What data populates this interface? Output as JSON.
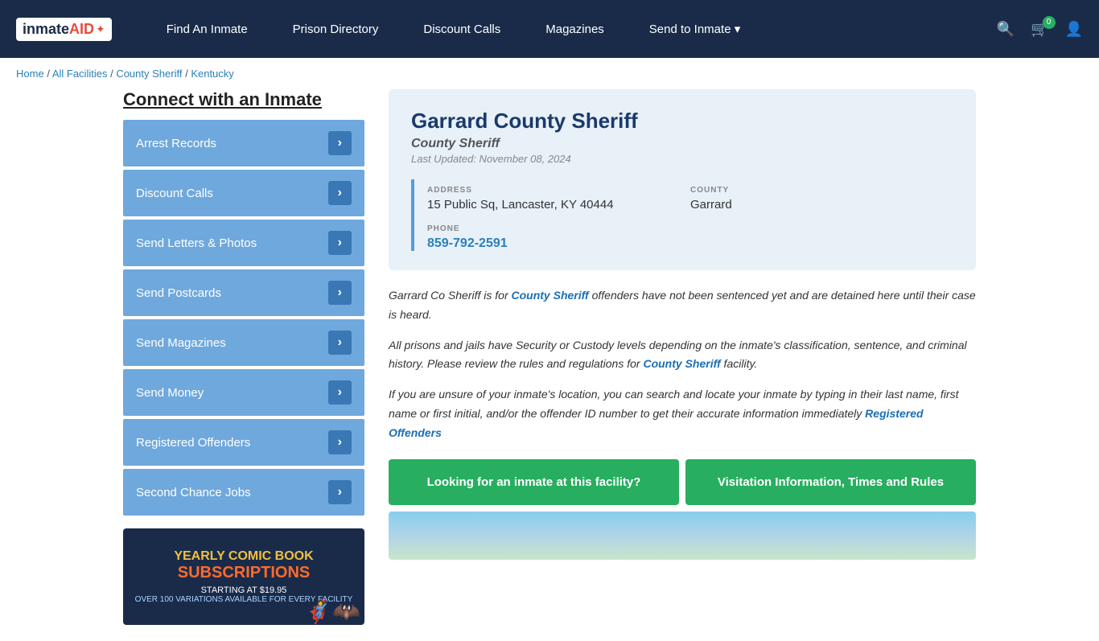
{
  "navbar": {
    "logo": {
      "text_inmate": "inmate",
      "text_aid": "AID",
      "bird": "🦅"
    },
    "links": [
      {
        "label": "Find An Inmate",
        "id": "find-an-inmate"
      },
      {
        "label": "Prison Directory",
        "id": "prison-directory"
      },
      {
        "label": "Discount Calls",
        "id": "discount-calls"
      },
      {
        "label": "Magazines",
        "id": "magazines"
      },
      {
        "label": "Send to Inmate ▾",
        "id": "send-to-inmate",
        "dropdown": true
      }
    ],
    "cart_badge": "0",
    "icons": {
      "search": "🔍",
      "cart": "🛒",
      "user": "👤"
    }
  },
  "breadcrumb": {
    "items": [
      {
        "label": "Home",
        "href": "#"
      },
      {
        "label": "All Facilities",
        "href": "#"
      },
      {
        "label": "County Sheriff",
        "href": "#"
      },
      {
        "label": "Kentucky",
        "href": "#"
      }
    ]
  },
  "sidebar": {
    "title": "Connect with an Inmate",
    "buttons": [
      {
        "label": "Arrest Records",
        "id": "arrest-records"
      },
      {
        "label": "Discount Calls",
        "id": "discount-calls-sidebar"
      },
      {
        "label": "Send Letters & Photos",
        "id": "send-letters-photos"
      },
      {
        "label": "Send Postcards",
        "id": "send-postcards"
      },
      {
        "label": "Send Magazines",
        "id": "send-magazines"
      },
      {
        "label": "Send Money",
        "id": "send-money"
      },
      {
        "label": "Registered Offenders",
        "id": "registered-offenders"
      },
      {
        "label": "Second Chance Jobs",
        "id": "second-chance-jobs"
      }
    ],
    "ad": {
      "line1": "YEARLY COMIC BOOK",
      "line2": "SUBSCRIPTIONS",
      "line3": "STARTING AT $19.95",
      "line4": "OVER 100 VARIATIONS AVAILABLE FOR EVERY FACILITY"
    }
  },
  "facility": {
    "name": "Garrard County Sheriff",
    "type": "County Sheriff",
    "last_updated": "Last Updated: November 08, 2024",
    "address_label": "ADDRESS",
    "address_value": "15 Public Sq, Lancaster, KY 40444",
    "county_label": "COUNTY",
    "county_value": "Garrard",
    "phone_label": "PHONE",
    "phone_value": "859-792-2591",
    "description": [
      "Garrard Co Sheriff is for County Sheriff offenders have not been sentenced yet and are detained here until their case is heard.",
      "All prisons and jails have Security or Custody levels depending on the inmate's classification, sentence, and criminal history. Please review the rules and regulations for County Sheriff facility.",
      "If you are unsure of your inmate's location, you can search and locate your inmate by typing in their last name, first name or first initial, and/or the offender ID number to get their accurate information immediately Registered Offenders"
    ],
    "cta": {
      "btn1": "Looking for an inmate at this facility?",
      "btn2": "Visitation Information, Times and Rules"
    }
  }
}
